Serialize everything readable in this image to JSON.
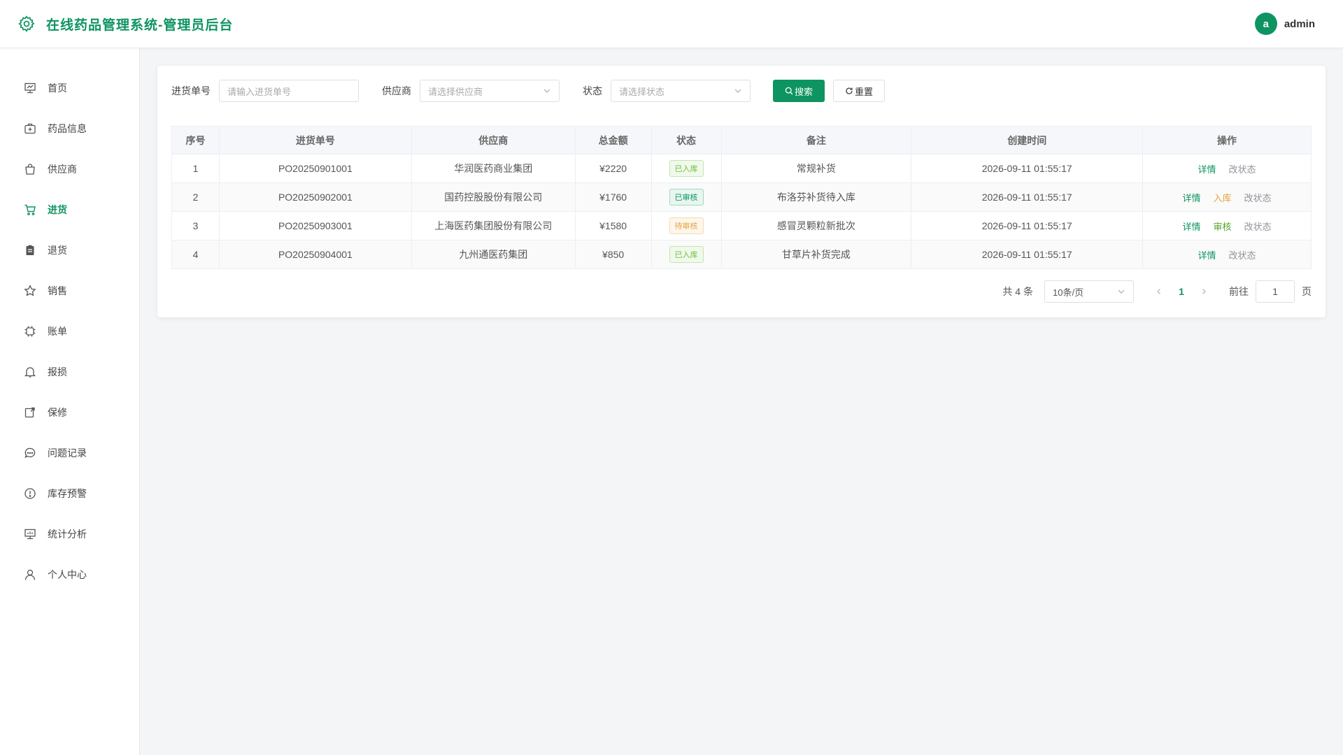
{
  "header": {
    "title": "在线药品管理系统-管理员后台",
    "avatar_letter": "a",
    "username": "admin"
  },
  "sidebar": {
    "items": [
      {
        "label": "首页",
        "icon": "dashboard-icon"
      },
      {
        "label": "药品信息",
        "icon": "medicine-box-icon"
      },
      {
        "label": "供应商",
        "icon": "shopping-bag-icon"
      },
      {
        "label": "进货",
        "icon": "cart-icon",
        "active": true
      },
      {
        "label": "退货",
        "icon": "clipboard-icon"
      },
      {
        "label": "销售",
        "icon": "star-icon"
      },
      {
        "label": "账单",
        "icon": "chip-icon"
      },
      {
        "label": "报损",
        "icon": "bell-icon"
      },
      {
        "label": "保修",
        "icon": "wrench-icon"
      },
      {
        "label": "问题记录",
        "icon": "chat-icon"
      },
      {
        "label": "库存预警",
        "icon": "warning-icon"
      },
      {
        "label": "统计分析",
        "icon": "chart-icon"
      },
      {
        "label": "个人中心",
        "icon": "user-icon"
      }
    ]
  },
  "filters": {
    "order_no_label": "进货单号",
    "order_no_placeholder": "请输入进货单号",
    "supplier_label": "供应商",
    "supplier_placeholder": "请选择供应商",
    "status_label": "状态",
    "status_placeholder": "请选择状态",
    "search_button": "搜索",
    "reset_button": "重置"
  },
  "table": {
    "headers": [
      "序号",
      "进货单号",
      "供应商",
      "总金额",
      "状态",
      "备注",
      "创建时间",
      "操作"
    ],
    "rows": [
      {
        "no": "1",
        "order": "PO20250901001",
        "supplier": "华润医药商业集团",
        "amount": "¥2220",
        "status": "已入库",
        "status_kind": "stored",
        "remark": "常规补货",
        "created": "2026-09-11 01:55:17",
        "actions": [
          {
            "label": "详情",
            "kind": "primary"
          },
          {
            "label": "改状态",
            "kind": "muted"
          }
        ]
      },
      {
        "no": "2",
        "order": "PO20250902001",
        "supplier": "国药控股股份有限公司",
        "amount": "¥1760",
        "status": "已审核",
        "status_kind": "approved",
        "remark": "布洛芬补货待入库",
        "created": "2026-09-11 01:55:17",
        "actions": [
          {
            "label": "详情",
            "kind": "primary"
          },
          {
            "label": "入库",
            "kind": "warning"
          },
          {
            "label": "改状态",
            "kind": "muted"
          }
        ]
      },
      {
        "no": "3",
        "order": "PO20250903001",
        "supplier": "上海医药集团股份有限公司",
        "amount": "¥1580",
        "status": "待审核",
        "status_kind": "pending",
        "remark": "感冒灵颗粒新批次",
        "created": "2026-09-11 01:55:17",
        "actions": [
          {
            "label": "详情",
            "kind": "primary"
          },
          {
            "label": "审核",
            "kind": "success"
          },
          {
            "label": "改状态",
            "kind": "muted"
          }
        ]
      },
      {
        "no": "4",
        "order": "PO20250904001",
        "supplier": "九州通医药集团",
        "amount": "¥850",
        "status": "已入库",
        "status_kind": "stored",
        "remark": "甘草片补货完成",
        "created": "2026-09-11 01:55:17",
        "actions": [
          {
            "label": "详情",
            "kind": "primary"
          },
          {
            "label": "改状态",
            "kind": "muted"
          }
        ]
      }
    ]
  },
  "pagination": {
    "total_text": "共 4 条",
    "page_size": "10条/页",
    "current_page": "1",
    "goto_label": "前往",
    "goto_value": "1",
    "page_suffix": "页"
  },
  "colors": {
    "brand": "#0e9461",
    "stored_tag": "#67c23a",
    "approved_tag": "#0e9461",
    "pending_tag": "#e6a23c",
    "warning_link": "#e6a23c",
    "success_link": "#52a32a",
    "muted_link": "#909399"
  }
}
